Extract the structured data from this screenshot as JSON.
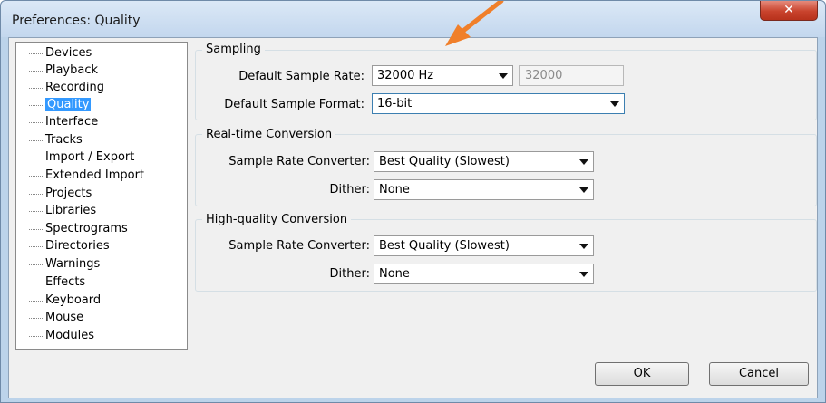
{
  "window": {
    "title": "Preferences: Quality",
    "close_glyph": "✕"
  },
  "tree": {
    "items": [
      "Devices",
      "Playback",
      "Recording",
      "Quality",
      "Interface",
      "Tracks",
      "Import / Export",
      "Extended Import",
      "Projects",
      "Libraries",
      "Spectrograms",
      "Directories",
      "Warnings",
      "Effects",
      "Keyboard",
      "Mouse",
      "Modules"
    ],
    "selected": "Quality"
  },
  "sampling": {
    "title": "Sampling",
    "rate_label": "Default Sample Rate:",
    "rate_value": "32000 Hz",
    "rate_text": "32000",
    "format_label": "Default Sample Format:",
    "format_value": "16-bit"
  },
  "realtime": {
    "title": "Real-time Conversion",
    "converter_label": "Sample Rate Converter:",
    "converter_value": "Best Quality (Slowest)",
    "dither_label": "Dither:",
    "dither_value": "None"
  },
  "highquality": {
    "title": "High-quality Conversion",
    "converter_label": "Sample Rate Converter:",
    "converter_value": "Best Quality (Slowest)",
    "dither_label": "Dither:",
    "dither_value": "None"
  },
  "buttons": {
    "ok": "OK",
    "cancel": "Cancel"
  },
  "colors": {
    "selection": "#3399ff",
    "annotation_arrow": "#f07f2a",
    "close_button": "#c9432d"
  }
}
